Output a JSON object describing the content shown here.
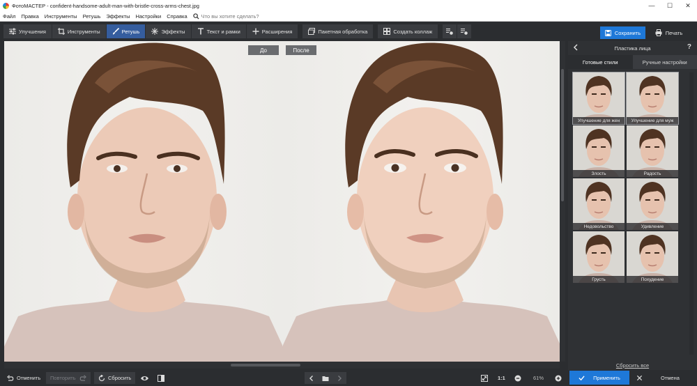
{
  "window": {
    "title": "ФотоМАСТЕР - confident-handsome-adult-man-with-bristle-cross-arms-chest.jpg",
    "minimize": "—",
    "maximize": "☐",
    "close": "✕"
  },
  "menu": {
    "items": [
      "Файл",
      "Правка",
      "Инструменты",
      "Ретушь",
      "Эффекты",
      "Настройки",
      "Справка"
    ],
    "search_placeholder": "Что вы хотите сделать?"
  },
  "toolbar": {
    "tabs": [
      {
        "label": "Улучшения",
        "icon": "sliders-icon",
        "active": false
      },
      {
        "label": "Инструменты",
        "icon": "crop-icon",
        "active": false
      },
      {
        "label": "Ретушь",
        "icon": "brush-icon",
        "active": true
      },
      {
        "label": "Эффекты",
        "icon": "sparkle-icon",
        "active": false
      },
      {
        "label": "Текст и рамки",
        "icon": "text-icon",
        "active": false
      },
      {
        "label": "Расширения",
        "icon": "plus-icon",
        "active": false
      }
    ],
    "batch_label": "Пакетная обработка",
    "collage_label": "Создать коллаж",
    "save_label": "Сохранить",
    "print_label": "Печать"
  },
  "canvas": {
    "before_label": "До",
    "after_label": "После"
  },
  "panel": {
    "title": "Пластика лица",
    "help": "?",
    "tabs": [
      {
        "label": "Готовые стили",
        "active": true
      },
      {
        "label": "Ручные настройки",
        "active": false
      }
    ],
    "styles": [
      {
        "label": "Улучшение для жен",
        "selected": true
      },
      {
        "label": "Улучшение для муж",
        "selected": true
      },
      {
        "label": "Злость",
        "selected": false
      },
      {
        "label": "Радость",
        "selected": false
      },
      {
        "label": "Недовольство",
        "selected": false
      },
      {
        "label": "Удивление",
        "selected": false
      },
      {
        "label": "Грусть",
        "selected": false
      },
      {
        "label": "Похудение",
        "selected": false
      }
    ],
    "reset_all_label": "Сбросить все"
  },
  "bottom": {
    "undo_label": "Отменить",
    "redo_label": "Повторить",
    "reset_label": "Сбросить",
    "actual_size_label": "1:1",
    "zoom_value": "61%",
    "apply_label": "Применить",
    "cancel_label": "Отмена"
  },
  "colors": {
    "accent": "#1e78d8",
    "active_tab": "#355d9e",
    "background": "#2b2d30"
  }
}
